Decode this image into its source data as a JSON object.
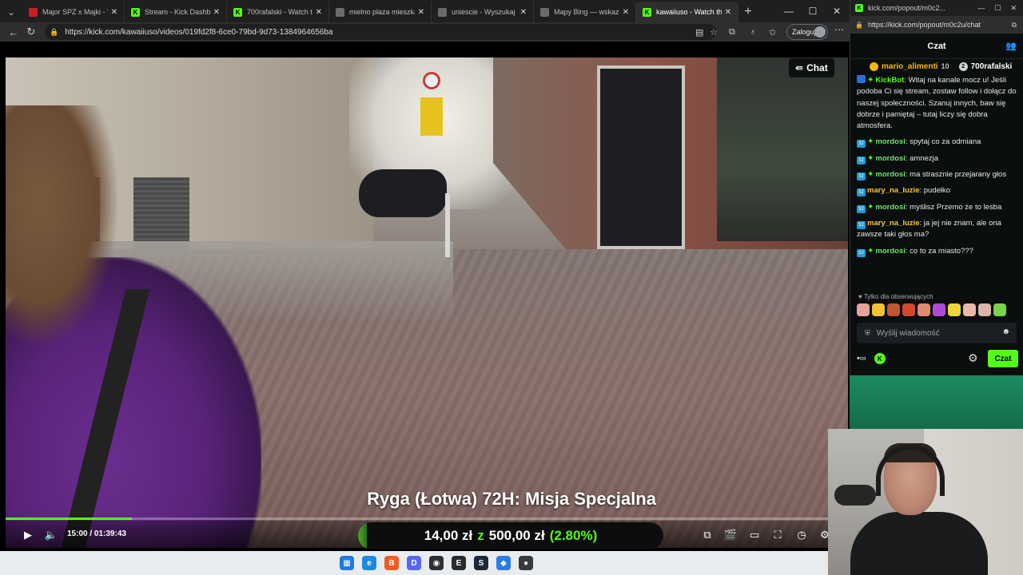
{
  "browser": {
    "tabs": [
      {
        "title": "Major SPZ x Majki - \"Kal",
        "favicon_color": "#cc1f1f",
        "favicon_glyph": "",
        "active": false
      },
      {
        "title": "Stream - Kick Dashboard",
        "favicon_color": "#53fc18",
        "favicon_glyph": "K",
        "active": false
      },
      {
        "title": "700rafalski - Watch the ",
        "favicon_color": "#53fc18",
        "favicon_glyph": "K",
        "active": false
      },
      {
        "title": "mielno plaza mieszkanie",
        "favicon_color": "#6b6b6b",
        "favicon_glyph": "",
        "active": false
      },
      {
        "title": "uniescie - Wyszukaj",
        "favicon_color": "#6b6b6b",
        "favicon_glyph": "",
        "active": false
      },
      {
        "title": "Mapy Bing — wskazówki",
        "favicon_color": "#6b6b6b",
        "favicon_glyph": "",
        "active": false
      },
      {
        "title": "kawaiiuso - Watch th",
        "favicon_color": "#53fc18",
        "favicon_glyph": "K",
        "active": true
      }
    ],
    "url": "https://kick.com/kawaiiuso/videos/019fd2f8-6ce0-79bd-9d73-1384964656ba",
    "login_label": "Zaloguj"
  },
  "video": {
    "chat_button": "Chat",
    "stream_title": "Ryga (Łotwa) 72H: Misja Specjalna",
    "time_current": "15:00",
    "time_separator": " / ",
    "time_total": "01:39:43",
    "progress_fraction": 0.15
  },
  "donation": {
    "amount": "14,00 zł",
    "separator": "z",
    "goal": "500,00 zł",
    "percent_text": "(2.80%)",
    "fraction": 0.028
  },
  "chat_window": {
    "url_title": "kick.com/popout/m0c2...",
    "url": "https://kick.com/popout/m0c2u/chat",
    "header": "Czat",
    "pinned": [
      {
        "name": "mario_alimenti",
        "rank": "10",
        "badge_color": "#f3b90f",
        "badge": ""
      },
      {
        "name": "700rafalski",
        "rank": "",
        "badge_color": "#d0d0d0",
        "badge": "2"
      }
    ],
    "messages": [
      {
        "user": "KickBot",
        "user_class": "u-kickbot",
        "text": ": Witaj na kanale mocz u! Jeśli podoba Ci się stream, zostaw follow i dołącz do naszej społeczności. Szanuj innych, baw się dobrze i pamiętaj – tutaj liczy się dobra atmosfera.",
        "badge_number": "",
        "spark": "✦"
      },
      {
        "user": "mordosi",
        "user_class": "u-mordo",
        "text": ": spytaj co za odmiana",
        "badge_number": "32",
        "spark": "✦"
      },
      {
        "user": "mordosi",
        "user_class": "u-mordo",
        "text": ": amnezja",
        "badge_number": "32",
        "spark": "✦"
      },
      {
        "user": "mordosi",
        "user_class": "u-mordo",
        "text": ": ma strasznie przejarany głos",
        "badge_number": "32",
        "spark": "✦"
      },
      {
        "user": "mary_na_luzie",
        "user_class": "u-mary",
        "text": ": pudełko",
        "badge_number": "32",
        "spark": ""
      },
      {
        "user": "mordosi",
        "user_class": "u-mordo",
        "text": ": myślisz Przemo że to lesba",
        "badge_number": "32",
        "spark": "✦"
      },
      {
        "user": "mary_na_luzie",
        "user_class": "u-mary",
        "text": ": ja jej nie znam, ale ona zawsze taki głos ma?",
        "badge_number": "32",
        "spark": ""
      },
      {
        "user": "mordosi",
        "user_class": "u-mordo",
        "text": ": co to za miasto???",
        "badge_number": "32",
        "spark": "✦"
      }
    ],
    "followers_only": "Tylko dla obserwujących",
    "emote_colors": [
      "#e6a39a",
      "#f2c230",
      "#c0552e",
      "#d24a2c",
      "#e08b70",
      "#b04ad6",
      "#f0d438",
      "#e8b9a8",
      "#d9b6a8",
      "#7bd34a"
    ],
    "input_placeholder": "Wyślij wiadomość",
    "send_label": "Czat"
  },
  "taskbar": {
    "icons": [
      {
        "name": "windows-start-icon",
        "color": "#1f7ae0",
        "glyph": "▦"
      },
      {
        "name": "edge-browser-icon",
        "color": "#1d8ae0",
        "glyph": "e"
      },
      {
        "name": "brave-browser-icon",
        "color": "#f25a24",
        "glyph": "B"
      },
      {
        "name": "discord-icon",
        "color": "#5865f2",
        "glyph": "D"
      },
      {
        "name": "chat-app-icon",
        "color": "#2f2f2f",
        "glyph": "◉"
      },
      {
        "name": "epic-games-icon",
        "color": "#2b2b2b",
        "glyph": "E"
      },
      {
        "name": "steam-icon",
        "color": "#1b2838",
        "glyph": "S"
      },
      {
        "name": "blue-app-icon",
        "color": "#2d7be5",
        "glyph": "◆"
      },
      {
        "name": "obs-studio-icon",
        "color": "#3a3a3a",
        "glyph": "●"
      }
    ]
  }
}
